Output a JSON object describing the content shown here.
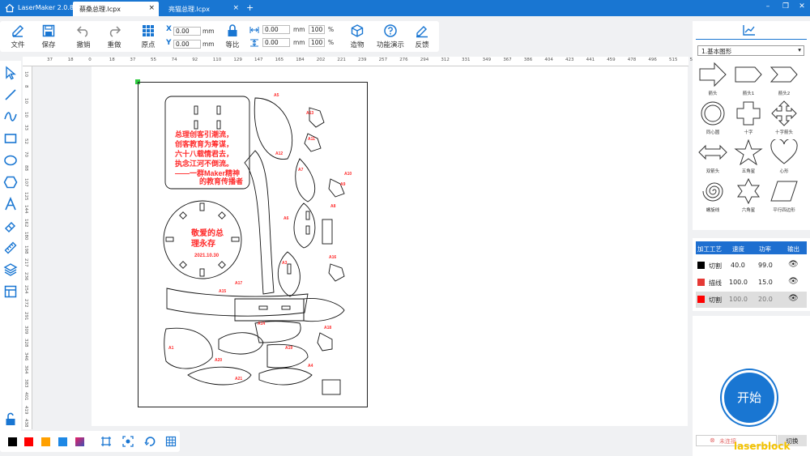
{
  "app": {
    "name": "LaserMaker 2.0.8"
  },
  "tabs": [
    {
      "label": "蔡桑总理.lcpx",
      "active": true
    },
    {
      "label": "亮猫总理.lcpx",
      "active": false
    }
  ],
  "toolbar": {
    "file": "文件",
    "save": "保存",
    "undo": "撤销",
    "redo": "重做",
    "origin": "原点",
    "x_label": "X",
    "x_value": "0.00",
    "y_label": "Y",
    "y_value": "0.00",
    "mm": "mm",
    "equal_ratio": "等比",
    "w_value": "0.00",
    "h_value": "0.00",
    "w_pct": "100",
    "h_pct": "100",
    "pct": "%",
    "build": "造物",
    "demo": "功能演示",
    "feedback": "反馈"
  },
  "ruler_top_ticks": [
    "37",
    "18",
    "0",
    "18",
    "37",
    "55",
    "74",
    "92",
    "110",
    "129",
    "147",
    "165",
    "184",
    "202",
    "221",
    "239",
    "257",
    "276",
    "294",
    "312",
    "331",
    "349",
    "367",
    "386",
    "404",
    "423",
    "441",
    "459",
    "478",
    "496",
    "515",
    "533"
  ],
  "ruler_left_ticks": [
    "10",
    "8",
    "10",
    "10",
    "33",
    "52",
    "70",
    "88",
    "107",
    "125",
    "144",
    "162",
    "180",
    "198",
    "217",
    "236",
    "254",
    "272",
    "291",
    "309",
    "328",
    "346",
    "364",
    "383",
    "401",
    "419",
    "438"
  ],
  "canvas_text": {
    "poem_lines": [
      "总理创客引潮流，",
      "创客教育为筹谋，",
      "六十八载情君去，",
      "执念江河不倒流。",
      "——一群Maker精神",
      "的教育传播者"
    ],
    "clock_text": [
      "敬爱的总",
      "理永存"
    ],
    "clock_date": "2021.10.30"
  },
  "part_labels": [
    "A5",
    "A12",
    "A13",
    "A11",
    "A10",
    "A7",
    "A9",
    "A6",
    "A8",
    "A3",
    "A16",
    "A17",
    "A15",
    "A19",
    "A14",
    "A18",
    "A20",
    "A21",
    "A4",
    "A1"
  ],
  "shapes": {
    "category": "1.基本图形",
    "items": [
      "箭头",
      "箭头1",
      "箭头2",
      "同心圆",
      "十字",
      "十字箭头",
      "双箭头",
      "五角星",
      "心形",
      "螺旋线",
      "六角星",
      "平行四边形"
    ]
  },
  "process": {
    "headers": [
      "加工工艺",
      "速度",
      "功率",
      "输出"
    ],
    "rows": [
      {
        "color": "#000000",
        "mode": "切割",
        "speed": "40.0",
        "power": "99.0"
      },
      {
        "color": "#e53935",
        "mode": "描线",
        "speed": "100.0",
        "power": "15.0"
      },
      {
        "color": "#ff0000",
        "mode": "切割",
        "speed": "100.0",
        "power": "20.0"
      }
    ]
  },
  "start": "开始",
  "connection": {
    "status": "未连接",
    "switch": "切换"
  },
  "watermark": "laserblock",
  "swatches": [
    "#000000",
    "#ff0000",
    "#ffa000",
    "#1e88e5",
    "#e91e63"
  ],
  "colors": {
    "accent": "#1976d2",
    "cut_red": "#ff2a2a"
  }
}
